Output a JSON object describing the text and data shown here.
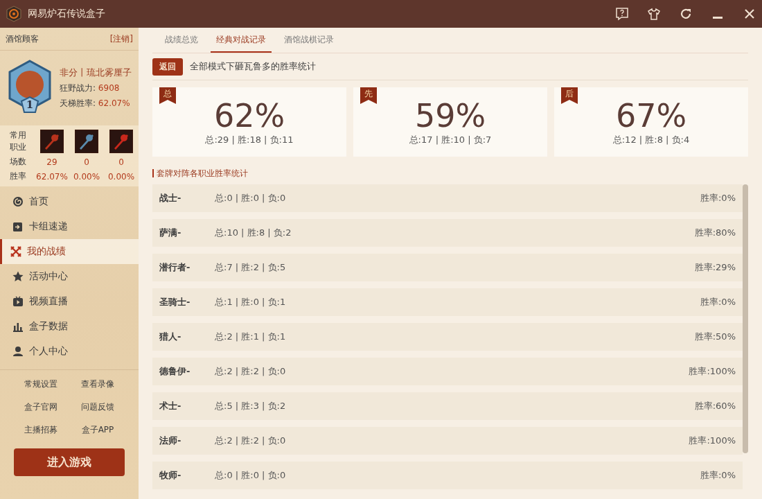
{
  "window": {
    "title": "网易炉石传说盒子"
  },
  "account": {
    "name": "酒馆顾客",
    "logout": "[注销]"
  },
  "profile": {
    "rank": "1",
    "nickname": "非分丨琉北雾厘子",
    "stats": [
      {
        "label": "狂野战力: ",
        "value": "6908"
      },
      {
        "label": "天梯胜率: ",
        "value": "62.07%"
      }
    ]
  },
  "classes": {
    "label": "常用职业",
    "games_label": "场数",
    "winrate_label": "胜率",
    "items": [
      {
        "games": "29",
        "winrate": "62.07%"
      },
      {
        "games": "0",
        "winrate": "0.00%"
      },
      {
        "games": "0",
        "winrate": "0.00%"
      }
    ]
  },
  "nav": [
    {
      "label": "首页",
      "selected": false
    },
    {
      "label": "卡组速递",
      "selected": false
    },
    {
      "label": "我的战绩",
      "selected": true
    },
    {
      "label": "活动中心",
      "selected": false
    },
    {
      "label": "视频直播",
      "selected": false
    },
    {
      "label": "盒子数据",
      "selected": false
    },
    {
      "label": "个人中心",
      "selected": false
    }
  ],
  "links": [
    "常规设置",
    "查看录像",
    "盒子官网",
    "问题反馈",
    "主播招募",
    "盒子APP"
  ],
  "play_button": "进入游戏",
  "tabs": [
    {
      "label": "战绩总览",
      "selected": false
    },
    {
      "label": "经典对战记录",
      "selected": true
    },
    {
      "label": "酒馆战棋记录",
      "selected": false
    }
  ],
  "back_button": "返回",
  "heading": "全部模式下砸瓦鲁多的胜率统计",
  "summary": [
    {
      "tag": "总",
      "percent": "62%",
      "detail": "总:29 | 胜:18 | 负:11"
    },
    {
      "tag": "先",
      "percent": "59%",
      "detail": "总:17 | 胜:10 | 负:7"
    },
    {
      "tag": "后",
      "percent": "67%",
      "detail": "总:12 | 胜:8 | 负:4"
    }
  ],
  "section_title": "套牌对阵各职业胜率统计",
  "rows": [
    {
      "class": "战士-",
      "record": "总:0 | 胜:0 | 负:0",
      "winrate": "胜率:0%"
    },
    {
      "class": "萨满-",
      "record": "总:10 | 胜:8 | 负:2",
      "winrate": "胜率:80%"
    },
    {
      "class": "潜行者-",
      "record": "总:7 | 胜:2 | 负:5",
      "winrate": "胜率:29%"
    },
    {
      "class": "圣骑士-",
      "record": "总:1 | 胜:0 | 负:1",
      "winrate": "胜率:0%"
    },
    {
      "class": "猎人-",
      "record": "总:2 | 胜:1 | 负:1",
      "winrate": "胜率:50%"
    },
    {
      "class": "德鲁伊-",
      "record": "总:2 | 胜:2 | 负:0",
      "winrate": "胜率:100%"
    },
    {
      "class": "术士-",
      "record": "总:5 | 胜:3 | 负:2",
      "winrate": "胜率:60%"
    },
    {
      "class": "法师-",
      "record": "总:2 | 胜:2 | 负:0",
      "winrate": "胜率:100%"
    },
    {
      "class": "牧师-",
      "record": "总:0 | 胜:0 | 负:0",
      "winrate": "胜率:0%"
    }
  ]
}
